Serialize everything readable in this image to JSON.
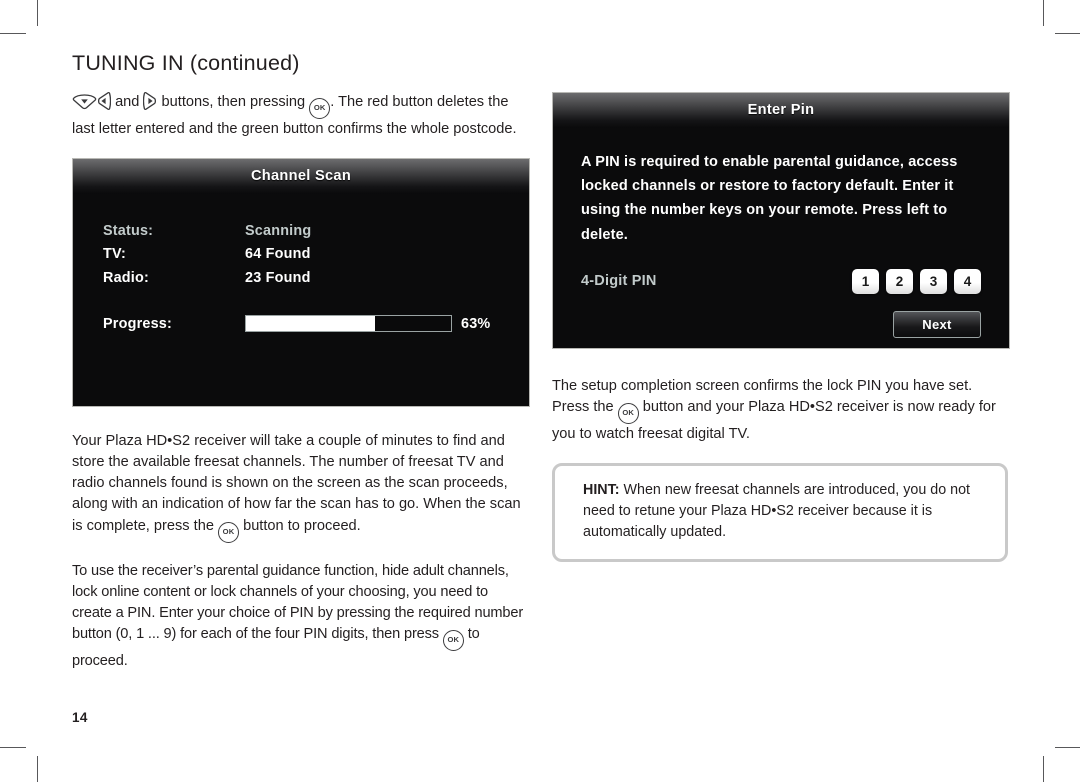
{
  "page": {
    "title": "TUNING IN (continued)",
    "number": "14"
  },
  "left_column": {
    "intro_paragraph": {
      "before_down_key": "",
      "after_down_key": "",
      "text_and": "and",
      "text_buttons": "buttons, then pressing",
      "text_tail": ". The red button deletes the last letter entered and the green button confirms the whole postcode."
    },
    "paragraph_scan": {
      "part1": "Your Plaza HD•S2 receiver will take a couple of minutes to find and store the available freesat channels. The number of freesat TV and radio channels found is shown on the screen as the scan proceeds, along with an indication of how far the scan has to go. When the scan is complete, press the",
      "part2": "button to proceed."
    },
    "paragraph_pin": {
      "part1": "To use the receiver’s parental guidance function, hide adult channels, lock online content or lock channels of your choosing, you need to create a PIN. Enter your choice of PIN by pressing the required number button (0, 1 ... 9) for each of the four PIN digits, then press",
      "part2": "to proceed."
    }
  },
  "channel_scan_panel": {
    "title": "Channel Scan",
    "rows": [
      {
        "label": "Status:",
        "value": "Scanning",
        "dim": true
      },
      {
        "label": "TV:",
        "value": "64 Found",
        "dim": false
      },
      {
        "label": "Radio:",
        "value": "23 Found",
        "dim": false
      }
    ],
    "progress": {
      "label": "Progress:",
      "percent_label": "63%",
      "percent_value": 63
    }
  },
  "enter_pin_panel": {
    "title": "Enter Pin",
    "description": "A PIN is required to enable parental guidance, access locked channels or restore to factory default. Enter it using the number keys on your remote. Press left to delete.",
    "pin_label": "4-Digit PIN",
    "pin_digits": [
      "1",
      "2",
      "3",
      "4"
    ],
    "next_button": "Next"
  },
  "right_column": {
    "paragraph_completion": {
      "part1": "The setup completion screen confirms the lock PIN you have set. Press the",
      "part2": "button and your Plaza HD•S2 receiver is now ready for you to watch freesat digital TV."
    },
    "hint": {
      "lead": "HINT:",
      "text": " When new freesat channels are introduced, you do not need to retune your Plaza HD•S2 receiver because it is automatically updated."
    }
  },
  "icons": {
    "ok_key": "OK",
    "down_key": "down-arrow-key",
    "left_key": "left-arrow-key",
    "right_key": "right-arrow-key"
  }
}
